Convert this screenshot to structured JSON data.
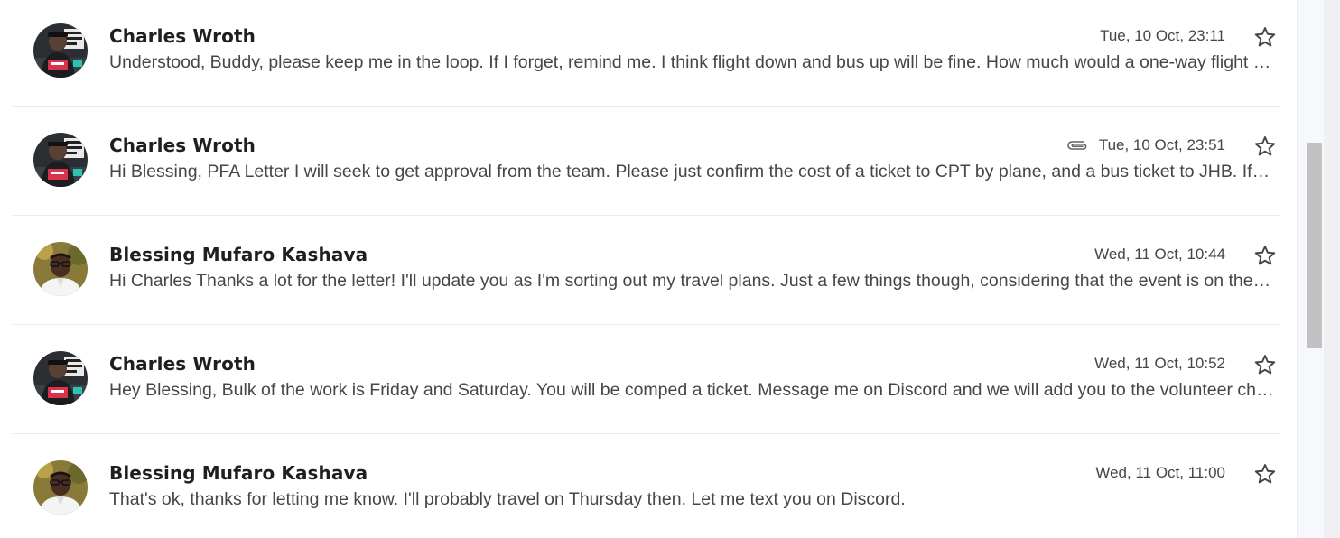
{
  "messages": [
    {
      "sender": "Charles Wroth",
      "snippet": "Understood, Buddy, please keep me in the loop. If I forget, remind me. I think flight down and bus up will be fine. How much would a one-way flight be to CPT?",
      "date": "Tue, 10 Oct, 23:11",
      "has_attachment": false,
      "avatar": "charles"
    },
    {
      "sender": "Charles Wroth",
      "snippet": "Hi Blessing, PFA Letter I will seek to get approval from the team. Please just confirm the cost of a ticket to CPT by plane, and a bus ticket to JHB. If we can",
      "date": "Tue, 10 Oct, 23:51",
      "has_attachment": true,
      "avatar": "charles"
    },
    {
      "sender": "Blessing Mufaro Kashava",
      "snippet": "Hi Charles Thanks a lot for the letter! I'll update you as I'm sorting out my travel plans. Just a few things though, considering that the event is on the weekend",
      "date": "Wed, 11 Oct, 10:44",
      "has_attachment": false,
      "avatar": "blessing"
    },
    {
      "sender": "Charles Wroth",
      "snippet": "Hey Blessing, Bulk of the work is Friday and Saturday. You will be comped a ticket. Message me on Discord and we will add you to the volunteer channel.",
      "date": "Wed, 11 Oct, 10:52",
      "has_attachment": false,
      "avatar": "charles"
    },
    {
      "sender": "Blessing Mufaro Kashava",
      "snippet": "That's ok, thanks for letting me know. I'll probably travel on Thursday then. Let me text you on Discord.",
      "date": "Wed, 11 Oct, 11:00",
      "has_attachment": false,
      "avatar": "blessing"
    }
  ],
  "icons": {
    "star": "star-outline-icon",
    "attachment": "paperclip-icon"
  },
  "colors": {
    "sender_text": "#1f1f1f",
    "snippet_text": "#444746",
    "divider": "#e7e9ec",
    "scrollbar_thumb": "#c1c1c1"
  }
}
